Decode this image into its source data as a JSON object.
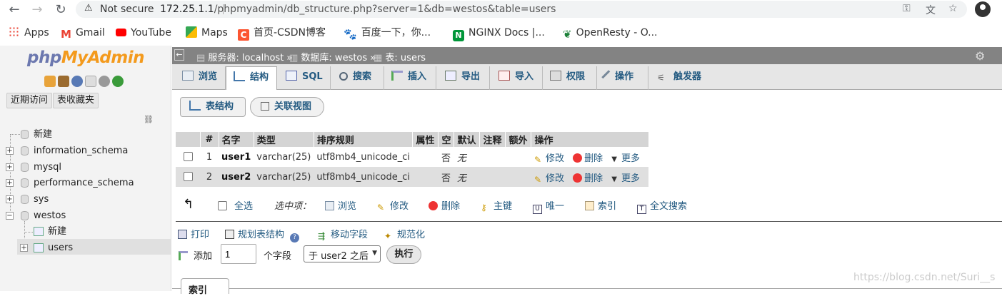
{
  "browser": {
    "security_label": "Not secure",
    "url_host": "172.25.1.1",
    "url_path": "/phpmyadmin/db_structure.php?server=1&db=westos&table=users"
  },
  "bookmarks": [
    {
      "label": "Apps",
      "icon": "apps-grid-icon"
    },
    {
      "label": "Gmail",
      "icon": "gmail-icon"
    },
    {
      "label": "YouTube",
      "icon": "youtube-icon"
    },
    {
      "label": "Maps",
      "icon": "maps-icon"
    },
    {
      "label": "首页-CSDN博客",
      "icon": "csdn-icon"
    },
    {
      "label": "百度一下，你...",
      "icon": "baidu-icon"
    },
    {
      "label": "NGINX Docs |...",
      "icon": "nginx-icon"
    },
    {
      "label": "OpenResty - O...",
      "icon": "openresty-icon"
    }
  ],
  "left_panel": {
    "logo": {
      "php": "php",
      "my": "My",
      "admin": "Admin"
    },
    "tabs": [
      "近期访问",
      "表收藏夹"
    ],
    "tree": {
      "new_label": "新建",
      "databases": [
        "information_schema",
        "mysql",
        "performance_schema",
        "sys",
        "westos"
      ],
      "westos_new": "新建",
      "westos_tables": [
        "users"
      ]
    }
  },
  "breadcrumb": {
    "server": "服务器: localhost »",
    "database": "数据库: westos »",
    "table": "表: users"
  },
  "menu_tabs": [
    "浏览",
    "结构",
    "SQL",
    "搜索",
    "插入",
    "导出",
    "导入",
    "权限",
    "操作",
    "触发器"
  ],
  "sub_tabs": [
    "表结构",
    "关联视图"
  ],
  "structure_table": {
    "headers": [
      "#",
      "名字",
      "类型",
      "排序规则",
      "属性",
      "空",
      "默认",
      "注释",
      "额外",
      "操作"
    ],
    "rows": [
      {
        "num": "1",
        "name": "user1",
        "type": "varchar(25)",
        "collation": "utf8mb4_unicode_ci",
        "attributes": "",
        "null": "否",
        "default": "无",
        "comment": "",
        "extra": ""
      },
      {
        "num": "2",
        "name": "user2",
        "type": "varchar(25)",
        "collation": "utf8mb4_unicode_ci",
        "attributes": "",
        "null": "否",
        "default": "无",
        "comment": "",
        "extra": ""
      }
    ],
    "actions": [
      "修改",
      "删除",
      "更多"
    ]
  },
  "bulk_actions": {
    "select_all": "全选",
    "with_selected": "选中项：",
    "items": [
      "浏览",
      "修改",
      "删除",
      "主键",
      "唯一",
      "索引",
      "全文搜索"
    ]
  },
  "tools": [
    "打印",
    "规划表结构",
    "移动字段",
    "规范化"
  ],
  "add_columns": {
    "add_label": "添加",
    "count": "1",
    "unit_label": "个字段",
    "position": "于 user2 之后",
    "go": "执行"
  },
  "index_tab": "索引",
  "watermark": "https://blog.csdn.net/Suri__s"
}
